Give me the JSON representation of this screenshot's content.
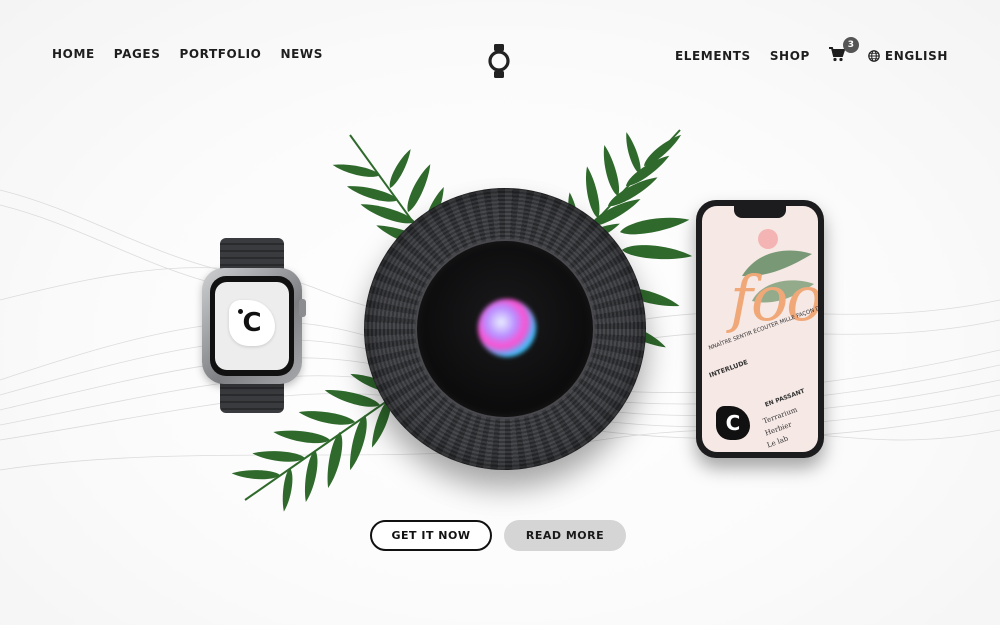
{
  "nav": {
    "left": [
      {
        "label": "HOME"
      },
      {
        "label": "PAGES"
      },
      {
        "label": "PORTFOLIO"
      },
      {
        "label": "NEWS"
      }
    ],
    "right": [
      {
        "label": "ELEMENTS"
      },
      {
        "label": "SHOP"
      }
    ],
    "cart_count": "3",
    "language": "ENGLISH",
    "logo_icon": "watch-icon"
  },
  "hero": {
    "watch_badge_letter": "C",
    "phone": {
      "big_text": "foo",
      "lines": [
        "NNAÎTRE SENTIR ÉCOUTER MILLE FAÇON DE",
        "INTERLUDE",
        "EN PASSANT",
        "Terrarium",
        "Herbier",
        "Le lab"
      ],
      "badge_letter": "C"
    }
  },
  "buttons": {
    "get_label": "GET IT NOW",
    "read_label": "READ MORE"
  },
  "colors": {
    "text": "#1e1e1e",
    "leaf": "#2f6a2c",
    "secondary_button": "#d5d5d5",
    "badge": "#555555"
  }
}
